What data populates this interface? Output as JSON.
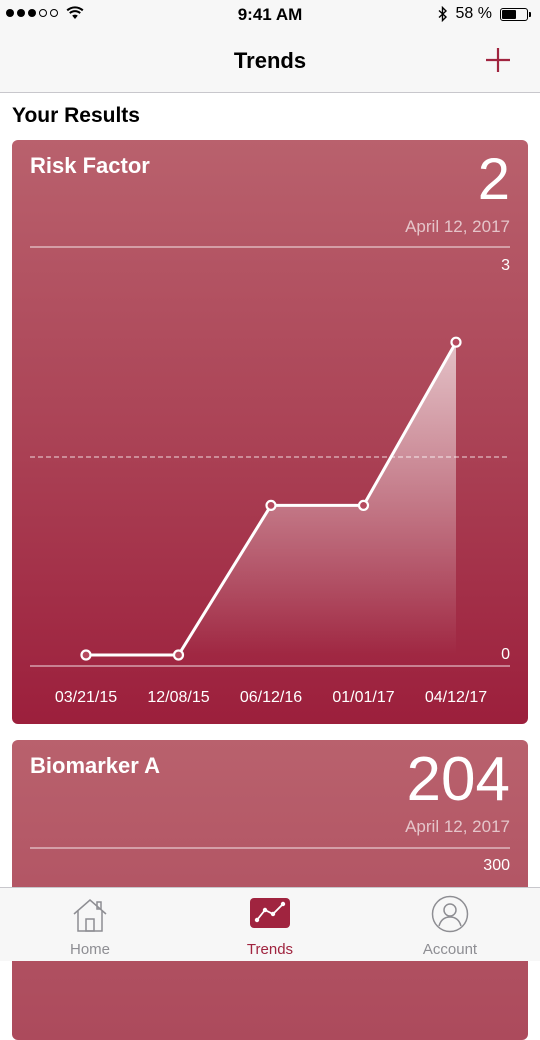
{
  "status_bar": {
    "time": "9:41 AM",
    "battery": "58 %",
    "battery_level": 0.58
  },
  "nav": {
    "title": "Trends"
  },
  "section": {
    "title": "Your Results"
  },
  "colors": {
    "accent": "#a0243f",
    "card_top": "#b9616d",
    "card_bottom": "#9c1f3c",
    "tab_inactive": "#8e8e93"
  },
  "cards": [
    {
      "title": "Risk Factor",
      "value": "2",
      "date": "April 12, 2017",
      "y_max_label": "3",
      "y_min_label": "0"
    },
    {
      "title": "Biomarker A",
      "value": "204",
      "date": "April 12, 2017",
      "y_max_label": "300"
    }
  ],
  "chart_data": {
    "type": "line",
    "categories": [
      "03/21/15",
      "12/08/15",
      "06/12/16",
      "01/01/17",
      "04/12/17"
    ],
    "values": [
      0,
      0,
      1.1,
      1.1,
      2.3
    ],
    "ylim": [
      0,
      3
    ],
    "grid": true
  },
  "tabs": [
    {
      "label": "Home",
      "icon": "home-icon"
    },
    {
      "label": "Trends",
      "icon": "trends-icon",
      "selected": true
    },
    {
      "label": "Account",
      "icon": "account-icon"
    }
  ]
}
